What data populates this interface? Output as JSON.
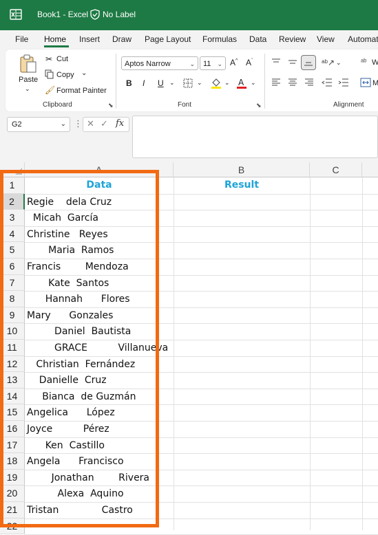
{
  "titlebar": {
    "app_title": "Book1  -  Excel",
    "label": "No Label"
  },
  "menu": {
    "tabs": [
      "File",
      "Home",
      "Insert",
      "Draw",
      "Page Layout",
      "Formulas",
      "Data",
      "Review",
      "View",
      "Automat"
    ],
    "active_tab": "Home"
  },
  "ribbon": {
    "clipboard": {
      "paste": "Paste",
      "cut": "Cut",
      "copy": "Copy",
      "format_painter": "Format Painter",
      "group_label": "Clipboard"
    },
    "font": {
      "font_name": "Aptos Narrow",
      "font_size": "11",
      "bold": "B",
      "italic": "I",
      "underline": "U",
      "group_label": "Font"
    },
    "alignment": {
      "group_label": "Alignment",
      "wrap_label": "W",
      "merge_label": "M"
    }
  },
  "formula_bar": {
    "name_box": "G2",
    "fx": "fx",
    "value": ""
  },
  "grid": {
    "columns": [
      "A",
      "B",
      "C"
    ],
    "headers": {
      "A": "Data",
      "B": "Result"
    },
    "rows": [
      {
        "num": "1"
      },
      {
        "num": "2",
        "a": "Regie    dela Cruz"
      },
      {
        "num": "3",
        "a": "  Micah  García"
      },
      {
        "num": "4",
        "a": "Christine   Reyes"
      },
      {
        "num": "5",
        "a": "       Maria  Ramos"
      },
      {
        "num": "6",
        "a": "Francis        Mendoza"
      },
      {
        "num": "7",
        "a": "       Kate  Santos"
      },
      {
        "num": "8",
        "a": "      Hannah      Flores"
      },
      {
        "num": "9",
        "a": "Mary      Gonzales"
      },
      {
        "num": "10",
        "a": "         Daniel  Bautista"
      },
      {
        "num": "11",
        "a": "         GRACE          Villanueva"
      },
      {
        "num": "12",
        "a": "   Christian  Fernández"
      },
      {
        "num": "13",
        "a": "    Danielle  Cruz"
      },
      {
        "num": "14",
        "a": "     Bianca  de Guzmán"
      },
      {
        "num": "15",
        "a": "Angelica      López"
      },
      {
        "num": "16",
        "a": "Joyce          Pérez"
      },
      {
        "num": "17",
        "a": "      Ken  Castillo"
      },
      {
        "num": "18",
        "a": "Angela      Francisco"
      },
      {
        "num": "19",
        "a": "        Jonathan        Rivera"
      },
      {
        "num": "20",
        "a": "          Alexa  Aquino"
      },
      {
        "num": "21",
        "a": "Tristan              Castro"
      },
      {
        "num": "22"
      }
    ],
    "selected_cell": "G2"
  },
  "colors": {
    "title_bar": "#1e7a45",
    "header_text": "#1ea3d8",
    "highlight": "#f26a12"
  }
}
